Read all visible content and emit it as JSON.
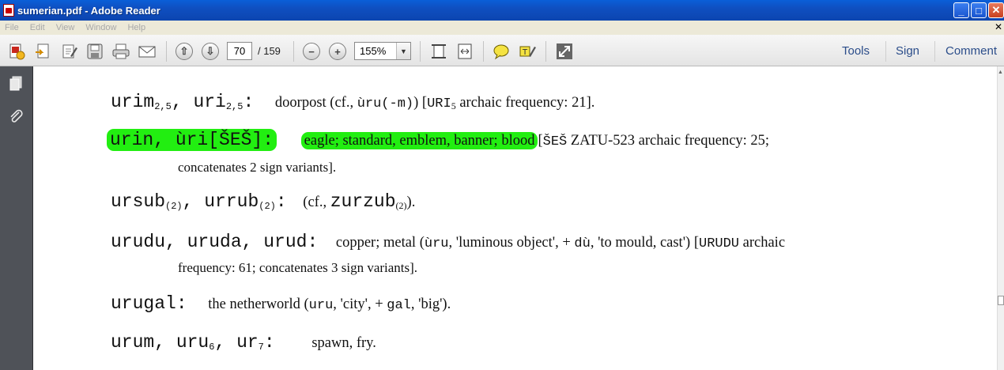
{
  "window": {
    "title": "sumerian.pdf - Adobe Reader",
    "buttons": {
      "minimize": "_",
      "maximize": "□",
      "close": "✕"
    }
  },
  "menu": {
    "items": [
      "File",
      "Edit",
      "View",
      "Window",
      "Help"
    ],
    "close_glyph": "✕"
  },
  "toolbar": {
    "icons": [
      "create-pdf-icon",
      "export-icon",
      "edit-icon",
      "save-icon",
      "print-icon",
      "email-icon",
      "page-up-icon",
      "page-down-icon",
      "zoom-out-icon",
      "zoom-in-icon",
      "fit-page-icon",
      "fit-width-icon",
      "comment-bubble-icon",
      "highlight-icon",
      "fullscreen-icon"
    ],
    "current_page": "70",
    "total_pages": "/ 159",
    "zoom": "155%",
    "zoom_arrow": "▼",
    "zoom_out": "−",
    "zoom_in": "+",
    "prev": "⇧",
    "next": "⇩",
    "tools_label": "Tools",
    "sign_label": "Sign",
    "comment_label": "Comment"
  },
  "document": {
    "entry1": {
      "w1": "urim",
      "w1sub": "2,5",
      "sep1": ", ",
      "w2": "uri",
      "w2sub": "2,5",
      "colon": ":",
      "gloss": "doorpost",
      "cf_open": "(cf., ",
      "cf_word": "ùru(-m)",
      "cf_close": ")",
      "sign_open": "[",
      "sign": "URI",
      "sign_sub": "5",
      "freq": " archaic frequency: 21]."
    },
    "entry2": {
      "headword": "urin, ùri[ŠEŠ]:",
      "gloss": "eagle; standard, emblem, banner; blood",
      "sign_open": "[",
      "sign": "ŠEŠ",
      "rest": " ZATU-523 archaic frequency: 25;",
      "continuation": "concatenates 2 sign variants]."
    },
    "entry3": {
      "w1": "ursub",
      "w1sub": "(2)",
      "sep": ", ",
      "w2": "urrub",
      "w2sub": "(2)",
      "colon": ":",
      "cf": "(cf., ",
      "cf_word": "zurzub",
      "cf_sub": "(2)",
      "cf_close": ")."
    },
    "entry4": {
      "headword": "urudu, uruda, urud:",
      "gloss": "copper; metal",
      "etym_open": "(",
      "w1": "ùru",
      "t1": ", 'luminous object', + ",
      "w2": "dù",
      "t2": ", 'to mould, cast')",
      "sign_open": " [",
      "sign": "URUDU",
      "rest": " archaic",
      "continuation": "frequency: 61; concatenates 3 sign variants]."
    },
    "entry5": {
      "headword": "urugal:",
      "gloss": "the netherworld",
      "etym_open": "(",
      "w1": "uru",
      "t1": ", 'city', + ",
      "w2": "gal",
      "t2": ", 'big')."
    },
    "entry6": {
      "w1": "urum",
      "sep1": ", ",
      "w2": "uru",
      "w2sub": "6",
      "sep2": ", ",
      "w3": "ur",
      "w3sub": "7",
      "colon": ":",
      "gloss": "spawn, fry."
    }
  },
  "colors": {
    "highlight": "#22ee11",
    "titlebar": "#0c45b0",
    "nav": "#4f5258"
  }
}
